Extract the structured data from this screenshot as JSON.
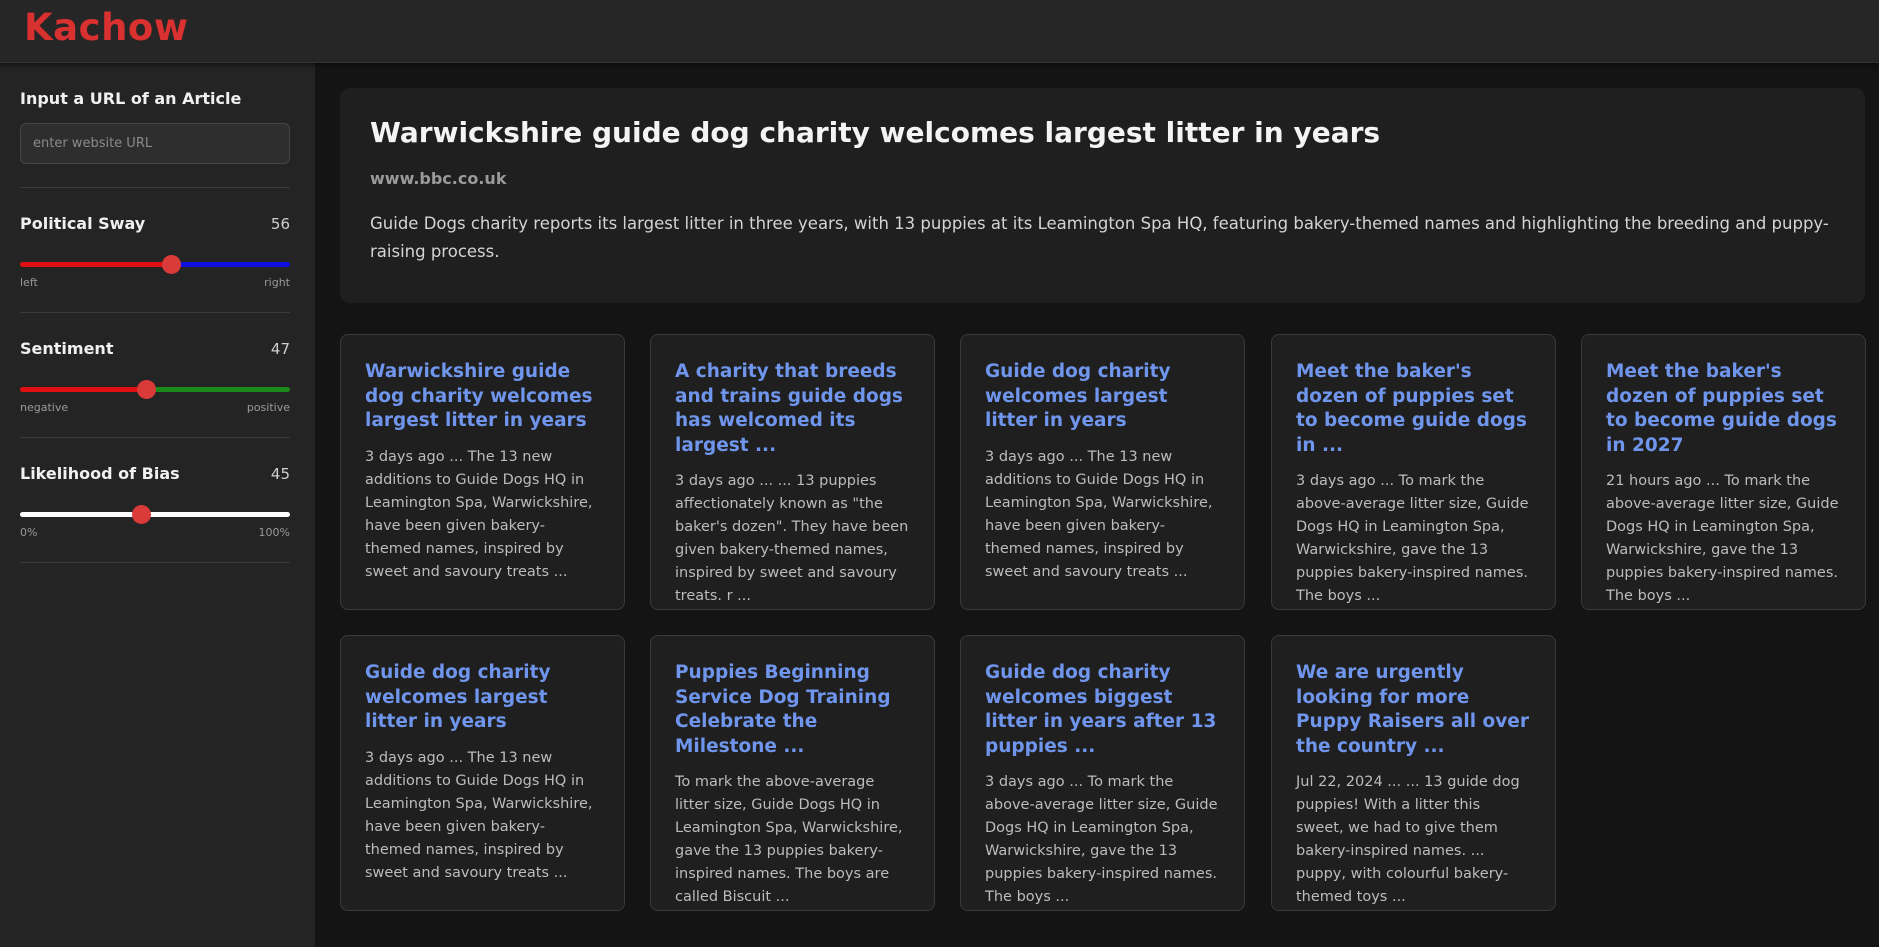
{
  "app": {
    "name": "Kachow"
  },
  "sidebar": {
    "url_label": "Input a URL of an Article",
    "url_placeholder": "enter website URL",
    "url_value": "",
    "sliders": [
      {
        "label": "Political Sway",
        "value": 56,
        "min_label": "left",
        "max_label": "right",
        "track_colors": [
          "#e01010",
          "#1010e0"
        ]
      },
      {
        "label": "Sentiment",
        "value": 47,
        "min_label": "negative",
        "max_label": "positive",
        "track_colors": [
          "#e01010",
          "#1a8a1a"
        ]
      },
      {
        "label": "Likelihood of Bias",
        "value": 45,
        "min_label": "0%",
        "max_label": "100%",
        "track_colors": [
          "#ffffff",
          "#ffffff"
        ]
      }
    ]
  },
  "featured": {
    "title": "Warwickshire guide dog charity welcomes largest litter in years",
    "source": "www.bbc.co.uk",
    "summary": "Guide Dogs charity reports its largest litter in three years, with 13 puppies at its Leamington Spa HQ, featuring bakery-themed names and highlighting the breeding and puppy-raising process."
  },
  "articles": [
    {
      "title": "Warwickshire guide dog charity welcomes largest litter in years",
      "snippet": "3 days ago ... The 13 new additions to Guide Dogs HQ in Leamington Spa, Warwickshire, have been given bakery-themed names, inspired by sweet and savoury treats ..."
    },
    {
      "title": "A charity that breeds and trains guide dogs has welcomed its largest ...",
      "snippet": "3 days ago ... ... 13 puppies affectionately known as \"the baker's dozen\". They have been given bakery-themed names, inspired by sweet and savoury treats. r ..."
    },
    {
      "title": "Guide dog charity welcomes largest litter in years",
      "snippet": "3 days ago ... The 13 new additions to Guide Dogs HQ in Leamington Spa, Warwickshire, have been given bakery-themed names, inspired by sweet and savoury treats ..."
    },
    {
      "title": "Meet the baker's dozen of puppies set to become guide dogs in ...",
      "snippet": "3 days ago ... To mark the above-average litter size, Guide Dogs HQ in Leamington Spa, Warwickshire, gave the 13 puppies bakery-inspired names. The boys ..."
    },
    {
      "title": "Meet the baker's dozen of puppies set to become guide dogs in 2027",
      "snippet": "21 hours ago ... To mark the above-average litter size, Guide Dogs HQ in Leamington Spa, Warwickshire, gave the 13 puppies bakery-inspired names. The boys ..."
    },
    {
      "title": "Guide dog charity welcomes largest litter in years",
      "snippet": "3 days ago ... The 13 new additions to Guide Dogs HQ in Leamington Spa, Warwickshire, have been given bakery-themed names, inspired by sweet and savoury treats ..."
    },
    {
      "title": "Puppies Beginning Service Dog Training Celebrate the Milestone ...",
      "snippet": "To mark the above-average litter size, Guide Dogs HQ in Leamington Spa, Warwickshire, gave the 13 puppies bakery-inspired names. The boys are called Biscuit ..."
    },
    {
      "title": "Guide dog charity welcomes biggest litter in years after 13 puppies ...",
      "snippet": "3 days ago ... To mark the above-average litter size, Guide Dogs HQ in Leamington Spa, Warwickshire, gave the 13 puppies bakery-inspired names. The boys ..."
    },
    {
      "title": "We are urgently looking for more Puppy Raisers all over the country ...",
      "snippet": "Jul 22, 2024 ... ... 13 guide dog puppies! With a litter this sweet, we had to give them bakery-inspired names. ... puppy, with colourful bakery-themed toys ..."
    }
  ]
}
